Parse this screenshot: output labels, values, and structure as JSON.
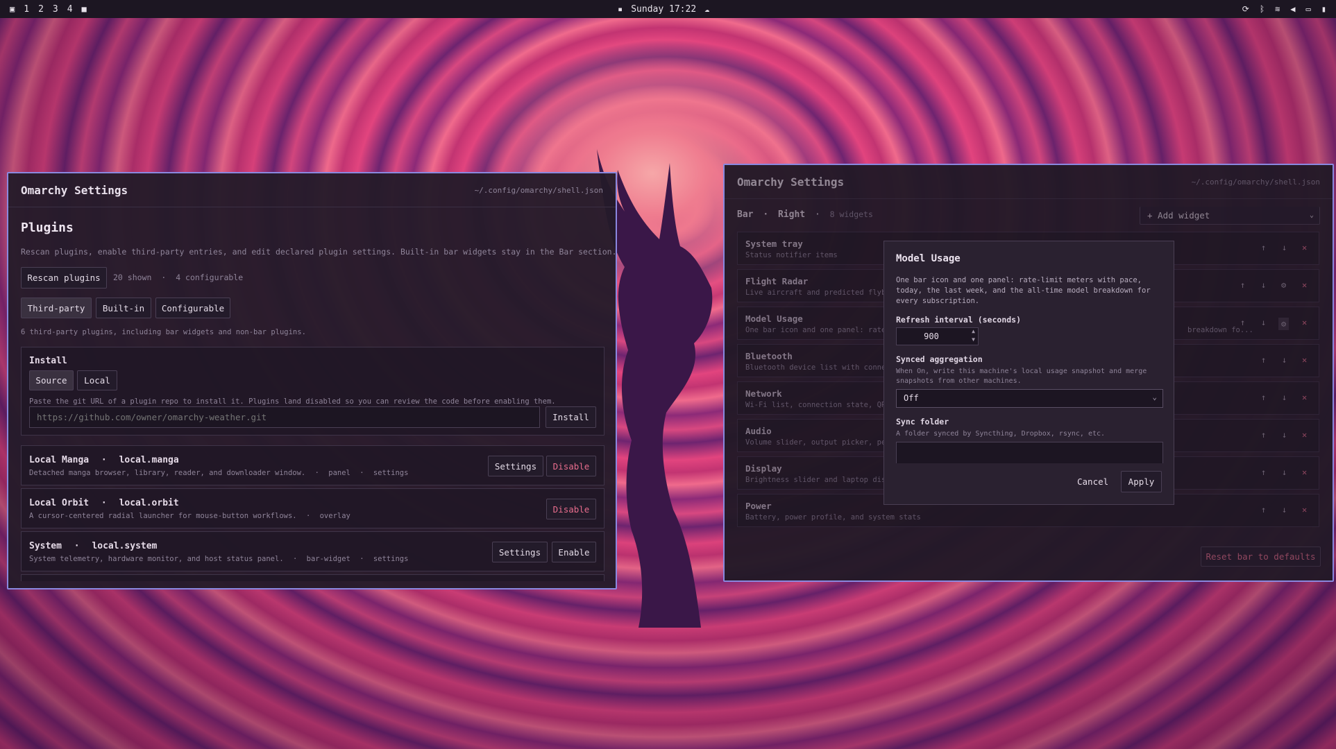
{
  "topbar": {
    "workspaces": [
      "1",
      "2",
      "3",
      "4"
    ],
    "clock": "Sunday 17:22"
  },
  "left_window": {
    "title": "Omarchy Settings",
    "path": "~/.config/omarchy/shell.json",
    "section_title": "Plugins",
    "section_desc": "Rescan plugins, enable third-party entries, and edit declared plugin settings. Built-in bar widgets stay in the Bar section.",
    "rescan_label": "Rescan plugins",
    "shown_count": "20 shown",
    "configurable_count": "4 configurable",
    "filters": [
      "Third-party",
      "Built-in",
      "Configurable"
    ],
    "filter_summary": "6 third-party plugins, including bar widgets and non-bar plugins.",
    "install": {
      "title": "Install",
      "tabs": [
        "Source",
        "Local"
      ],
      "help": "Paste the git URL of a plugin repo to install it. Plugins land disabled so you can review the code before enabling them.",
      "placeholder": "https://github.com/owner/omarchy-weather.git",
      "button": "Install"
    },
    "plugins": [
      {
        "name": "Local Manga",
        "id": "local.manga",
        "desc": "Detached manga browser, library, reader, and downloader window.",
        "tags": [
          "panel",
          "settings"
        ],
        "settings": "Settings",
        "action": "Disable"
      },
      {
        "name": "Local Orbit",
        "id": "local.orbit",
        "desc": "A cursor-centered radial launcher for mouse-button workflows.",
        "tags": [
          "overlay"
        ],
        "action": "Disable"
      },
      {
        "name": "System",
        "id": "local.system",
        "desc": "System telemetry, hardware monitor, and host status panel.",
        "tags": [
          "bar-widget",
          "settings"
        ],
        "settings": "Settings",
        "action": "Enable"
      }
    ],
    "separator": "·"
  },
  "right_window": {
    "title": "Omarchy Settings",
    "path": "~/.config/omarchy/shell.json",
    "crumb_bar": "Bar",
    "crumb_side": "Right",
    "widget_count": "8 widgets",
    "add_widget": "+ Add widget",
    "widgets": [
      {
        "name": "System tray",
        "desc": "Status notifier items"
      },
      {
        "name": "Flight Radar",
        "desc": "Live aircraft and predicted flyby"
      },
      {
        "name": "Model Usage",
        "desc": "One bar icon and one panel: rate-",
        "desc_tail": "breakdown fo..."
      },
      {
        "name": "Bluetooth",
        "desc": "Bluetooth device list with connect"
      },
      {
        "name": "Network",
        "desc": "Wi-Fi list, connection state, QR"
      },
      {
        "name": "Audio",
        "desc": "Volume slider, output picker, per"
      },
      {
        "name": "Display",
        "desc": "Brightness slider and laptop disp"
      },
      {
        "name": "Power",
        "desc": "Battery, power profile, and system stats"
      }
    ],
    "reset_label": "Reset bar to defaults"
  },
  "modal": {
    "title": "Model Usage",
    "desc": "One bar icon and one panel: rate-limit meters with pace, today, the last week, and the all-time model breakdown for every subscription.",
    "refresh_label": "Refresh interval (seconds)",
    "refresh_value": "900",
    "sync_label": "Synced aggregation",
    "sync_help": "When On, write this machine's local usage snapshot and merge snapshots from other machines.",
    "sync_value": "Off",
    "folder_label": "Sync folder",
    "folder_help": "A folder synced by Syncthing, Dropbox, rsync, etc.",
    "folder_value": "",
    "cancel": "Cancel",
    "apply": "Apply"
  },
  "colors": {
    "accent_border": "#8a88e0",
    "danger": "#e86d8d",
    "bar_bg": "#1c1622"
  }
}
